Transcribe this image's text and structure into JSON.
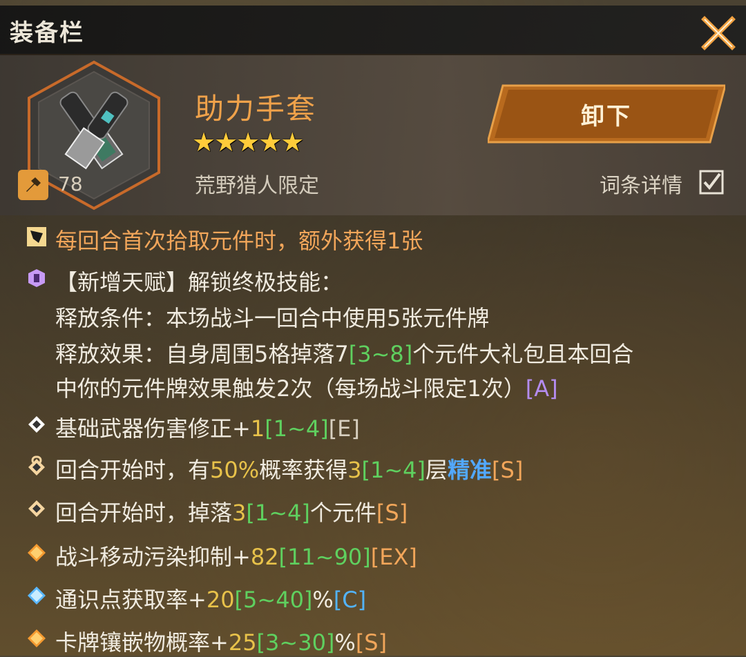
{
  "header": {
    "title": "装备栏"
  },
  "item": {
    "name": "助力手套",
    "stars": "★★★★★",
    "subtitle": "荒野猎人限定",
    "level": "78",
    "unequip_label": "卸下",
    "detail_toggle_label": "词条详情"
  },
  "lines": {
    "l1": "每回合首次拾取元件时，额外获得1张",
    "l2": "【新增天赋】解锁终极技能：",
    "l3": "释放条件：本场战斗一回合中使用5张元件牌",
    "l4a": "释放效果：自身周围5格掉落7",
    "l4b": "[3~8]",
    "l4c": "个元件大礼包且本回合",
    "l5a": "中你的元件牌效果触发2次（每场战斗限定1次）",
    "l5b": "[A]",
    "l6a": "基础武器伤害修正+",
    "l6b": "1",
    "l6c": "[1~4]",
    "l6d": "[E]",
    "l7a": "回合开始时，有",
    "l7b": "50%",
    "l7c": "概率获得",
    "l7d": "3",
    "l7e": "[1~4]",
    "l7f": "层",
    "l7g": "精准",
    "l7h": "[S]",
    "l8a": "回合开始时，掉落",
    "l8b": "3",
    "l8c": "[1~4]",
    "l8d": "个元件",
    "l8e": "[S]",
    "l9a": "战斗移动污染抑制+",
    "l9b": "82",
    "l9c": "[11~90]",
    "l9d": "[EX]",
    "l10a": "通识点获取率+",
    "l10b": "20",
    "l10c": "[5~40]",
    "l10d": "%",
    "l10e": "[C]",
    "l11a": "卡牌镶嵌物概率+",
    "l11b": "25",
    "l11c": "[3~30]",
    "l11d": "%",
    "l11e": "[S]"
  }
}
